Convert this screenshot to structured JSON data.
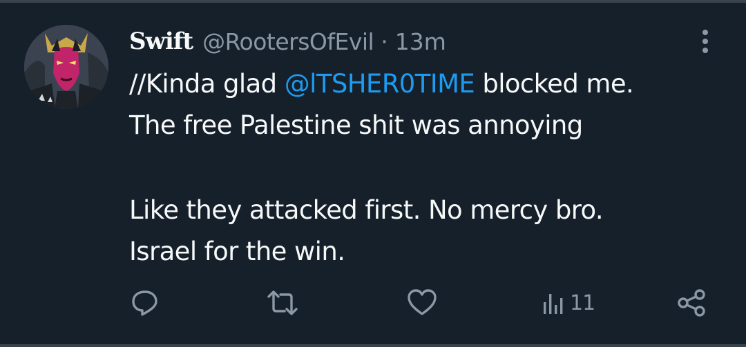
{
  "tweet": {
    "display_name": "Swift",
    "handle": "@RootersOfEvil",
    "separator": "·",
    "time": "13m",
    "body": {
      "line1_prefix": "//Kinda glad ",
      "mention": "@lTSHER0TIME",
      "line1_suffix": " blocked me.",
      "line2": "The free Palestine shit was annoying",
      "line3": "Like they attacked first. No mercy bro.",
      "line4": "Israel for the win."
    }
  },
  "actions": {
    "views_count": "11"
  },
  "icons": {
    "reply": "reply-icon",
    "retweet": "retweet-icon",
    "like": "heart-icon",
    "views": "views-icon",
    "share": "share-icon",
    "more": "more-vertical-icon"
  },
  "colors": {
    "background": "#15202b",
    "text": "#f7f9f9",
    "secondary_text": "#8b98a5",
    "mention": "#1d9bf0"
  }
}
